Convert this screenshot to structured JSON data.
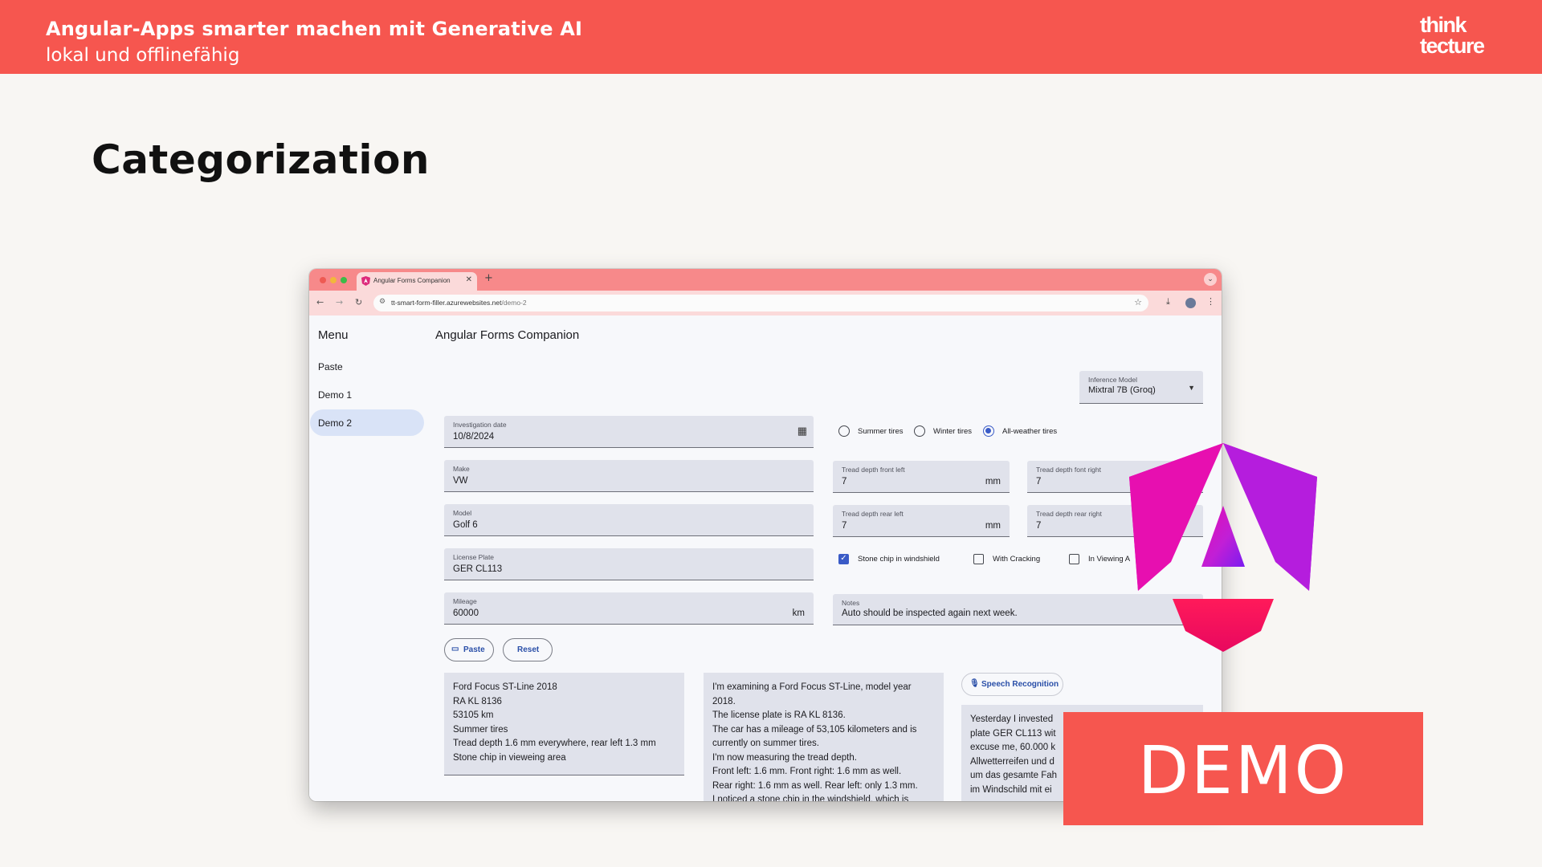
{
  "slide": {
    "title": "Angular-Apps smarter machen mit Generative AI",
    "subtitle": "lokal und offlinefähig",
    "logo_line1": "think",
    "logo_line2": "tecture",
    "section_title": "Categorization"
  },
  "browser": {
    "tab_title": "Angular Forms Companion",
    "url_host": "tt-smart-form-filler.azurewebsites.net",
    "url_path": "/demo-2"
  },
  "app": {
    "menu_title": "Menu",
    "menu_items": [
      "Paste",
      "Demo 1",
      "Demo 2"
    ],
    "active_menu_item": "Demo 2",
    "title": "Angular Forms Companion",
    "inference_model": {
      "label": "Inference Model",
      "value": "Mixtral 7B (Groq)"
    },
    "fields": {
      "investigation_date": {
        "label": "Investigation date",
        "value": "10/8/2024"
      },
      "make": {
        "label": "Make",
        "value": "VW"
      },
      "model": {
        "label": "Model",
        "value": "Golf 6"
      },
      "license_plate": {
        "label": "License Plate",
        "value": "GER CL113"
      },
      "mileage": {
        "label": "Mileage",
        "value": "60000",
        "suffix": "km"
      },
      "tread_front_left": {
        "label": "Tread depth front left",
        "value": "7",
        "suffix": "mm"
      },
      "tread_front_right": {
        "label": "Tread depth font right",
        "value": "7"
      },
      "tread_rear_left": {
        "label": "Tread depth rear left",
        "value": "7",
        "suffix": "mm"
      },
      "tread_rear_right": {
        "label": "Tread depth rear right",
        "value": "7"
      },
      "notes": {
        "label": "Notes",
        "value": "Auto should be inspected again next week."
      }
    },
    "tire_options": [
      {
        "label": "Summer tires",
        "checked": false
      },
      {
        "label": "Winter tires",
        "checked": false
      },
      {
        "label": "All-weather tires",
        "checked": true
      }
    ],
    "damage_options": [
      {
        "label": "Stone chip in windshield",
        "checked": true
      },
      {
        "label": "With Cracking",
        "checked": false
      },
      {
        "label": "In Viewing A",
        "checked": false
      }
    ],
    "buttons": {
      "paste": "Paste",
      "reset": "Reset",
      "speech": "Speech Recognition"
    },
    "text_sample_1": [
      "Ford Focus ST-Line 2018",
      "RA KL 8136",
      "53105 km",
      "Summer tires",
      "Tread depth 1.6 mm everywhere, rear left 1.3 mm",
      "Stone chip in vieweing area"
    ],
    "text_sample_2": [
      "I'm examining a Ford Focus ST-Line, model year",
      "2018.",
      "The license plate is RA KL 8136.",
      "The car has a mileage of 53,105 kilometers and is",
      "currently on summer tires.",
      "I'm now measuring the tread depth.",
      "Front left: 1.6 mm. Front right: 1.6 mm as well.",
      "Rear right: 1.6 mm as well. Rear left: only 1.3 mm.",
      "I noticed a stone chip in the windshield, which is"
    ],
    "text_sample_3": [
      "Yesterday I invested",
      "plate GER CL113 wit",
      "excuse me, 60.000 k",
      "Allwetterreifen und d",
      "um das gesamte Fah",
      "im Windschild mit ei"
    ]
  },
  "demo_label": "DEMO",
  "colors": {
    "brand": "#f6564f",
    "accent": "#3a5bc7"
  }
}
